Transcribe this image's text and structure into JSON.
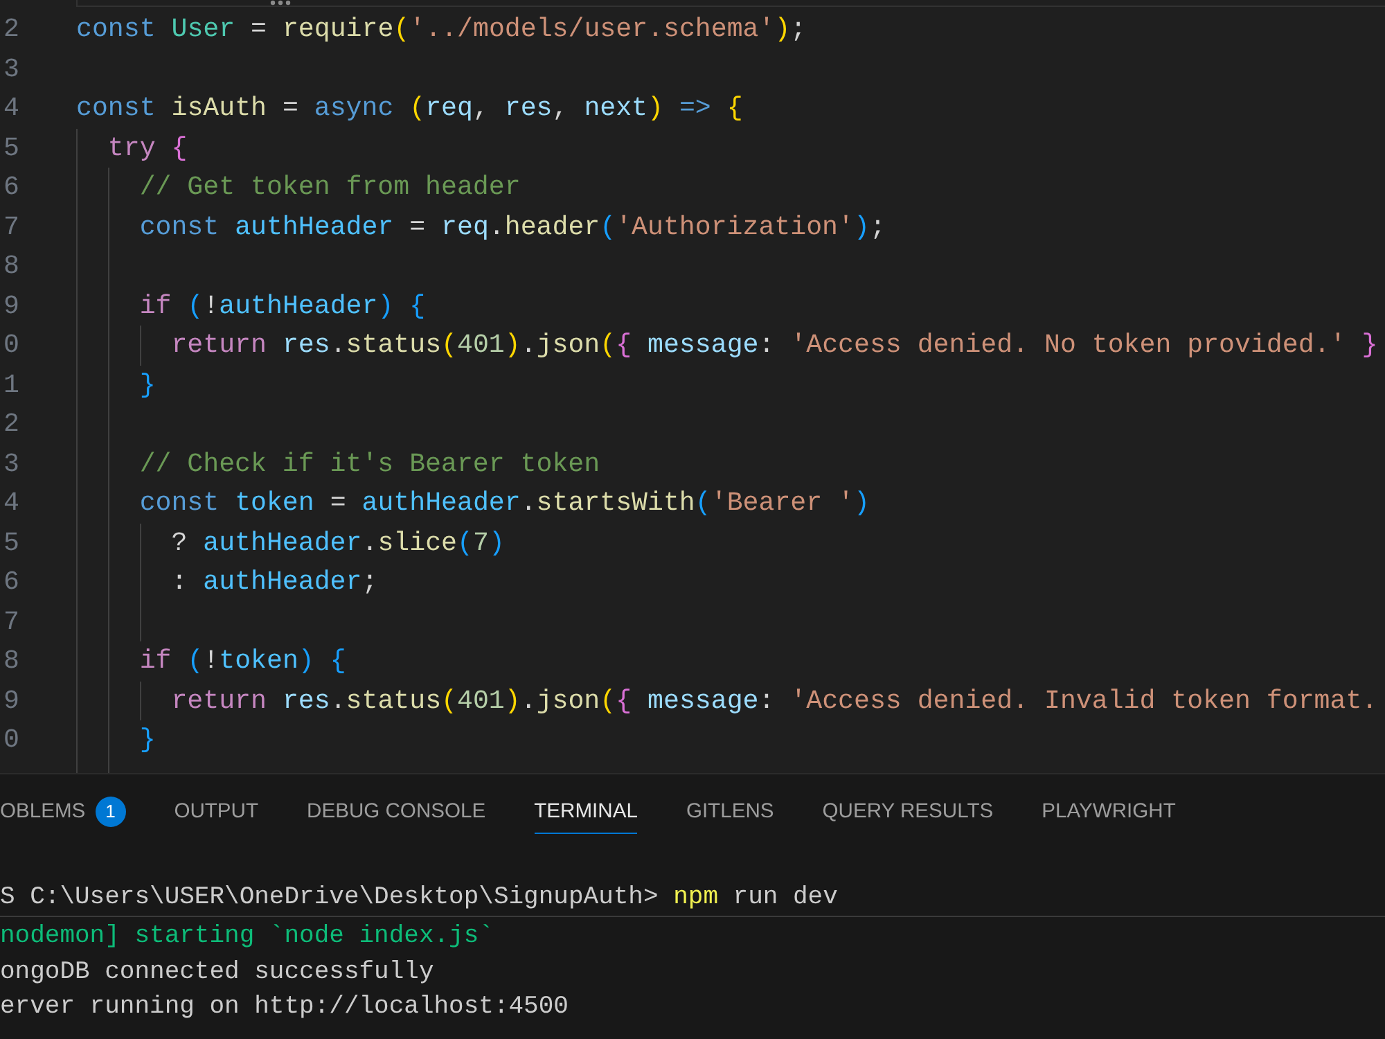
{
  "editor": {
    "lines": [
      {
        "number": "2",
        "tokens": [
          {
            "text": "const ",
            "kind": "keyword"
          },
          {
            "text": "User",
            "kind": "type"
          },
          {
            "text": " = ",
            "kind": "plain"
          },
          {
            "text": "require",
            "kind": "function"
          },
          {
            "text": "(",
            "kind": "bracket1"
          },
          {
            "text": "'../models/user.schema'",
            "kind": "string"
          },
          {
            "text": ")",
            "kind": "bracket1"
          },
          {
            "text": ";",
            "kind": "plain"
          }
        ]
      },
      {
        "number": "3"
      },
      {
        "number": "4",
        "tokens": [
          {
            "text": "const ",
            "kind": "keyword"
          },
          {
            "text": "isAuth",
            "kind": "function"
          },
          {
            "text": " = ",
            "kind": "plain"
          },
          {
            "text": "async ",
            "kind": "keyword"
          },
          {
            "text": "(",
            "kind": "bracket1"
          },
          {
            "text": "req",
            "kind": "variable"
          },
          {
            "text": ", ",
            "kind": "plain"
          },
          {
            "text": "res",
            "kind": "variable"
          },
          {
            "text": ", ",
            "kind": "plain"
          },
          {
            "text": "next",
            "kind": "variable"
          },
          {
            "text": ")",
            "kind": "bracket1"
          },
          {
            "text": " => ",
            "kind": "keyword"
          },
          {
            "text": "{",
            "kind": "bracket1"
          }
        ],
        "children": [
          {
            "number": "5",
            "tokens": [
              {
                "text": "try ",
                "kind": "control"
              },
              {
                "text": "{",
                "kind": "bracket2"
              }
            ],
            "children": [
              {
                "number": "6",
                "tokens": [
                  {
                    "text": "// Get token from header",
                    "kind": "comment"
                  }
                ]
              },
              {
                "number": "7",
                "tokens": [
                  {
                    "text": "const ",
                    "kind": "keyword"
                  },
                  {
                    "text": "authHeader",
                    "kind": "constant"
                  },
                  {
                    "text": " = ",
                    "kind": "plain"
                  },
                  {
                    "text": "req",
                    "kind": "variable"
                  },
                  {
                    "text": ".",
                    "kind": "plain"
                  },
                  {
                    "text": "header",
                    "kind": "function"
                  },
                  {
                    "text": "(",
                    "kind": "bracket3"
                  },
                  {
                    "text": "'Authorization'",
                    "kind": "string"
                  },
                  {
                    "text": ")",
                    "kind": "bracket3"
                  },
                  {
                    "text": ";",
                    "kind": "plain"
                  }
                ]
              },
              {
                "number": "8"
              },
              {
                "number": "9",
                "tokens": [
                  {
                    "text": "if ",
                    "kind": "control"
                  },
                  {
                    "text": "(",
                    "kind": "bracket3"
                  },
                  {
                    "text": "!",
                    "kind": "plain"
                  },
                  {
                    "text": "authHeader",
                    "kind": "constant"
                  },
                  {
                    "text": ") {",
                    "kind": "bracket3"
                  }
                ],
                "children": [
                  {
                    "number": "0",
                    "tokens": [
                      {
                        "text": "return ",
                        "kind": "control"
                      },
                      {
                        "text": "res",
                        "kind": "variable"
                      },
                      {
                        "text": ".",
                        "kind": "plain"
                      },
                      {
                        "text": "status",
                        "kind": "function"
                      },
                      {
                        "text": "(",
                        "kind": "bracket1"
                      },
                      {
                        "text": "401",
                        "kind": "number"
                      },
                      {
                        "text": ")",
                        "kind": "bracket1"
                      },
                      {
                        "text": ".",
                        "kind": "plain"
                      },
                      {
                        "text": "json",
                        "kind": "function"
                      },
                      {
                        "text": "(",
                        "kind": "bracket1"
                      },
                      {
                        "text": "{ ",
                        "kind": "bracket2"
                      },
                      {
                        "text": "message",
                        "kind": "variable"
                      },
                      {
                        "text": ": ",
                        "kind": "plain"
                      },
                      {
                        "text": "'Access denied. No token provided.'",
                        "kind": "string"
                      },
                      {
                        "text": " }",
                        "kind": "bracket2"
                      }
                    ]
                  }
                ]
              },
              {
                "number": "1",
                "tokens": [
                  {
                    "text": "}",
                    "kind": "bracket3"
                  }
                ]
              },
              {
                "number": "2"
              },
              {
                "number": "3",
                "tokens": [
                  {
                    "text": "// Check if it's Bearer token",
                    "kind": "comment"
                  }
                ]
              },
              {
                "number": "4",
                "tokens": [
                  {
                    "text": "const ",
                    "kind": "keyword"
                  },
                  {
                    "text": "token",
                    "kind": "constant"
                  },
                  {
                    "text": " = ",
                    "kind": "plain"
                  },
                  {
                    "text": "authHeader",
                    "kind": "constant"
                  },
                  {
                    "text": ".",
                    "kind": "plain"
                  },
                  {
                    "text": "startsWith",
                    "kind": "function"
                  },
                  {
                    "text": "(",
                    "kind": "bracket3"
                  },
                  {
                    "text": "'Bearer '",
                    "kind": "string"
                  },
                  {
                    "text": ")",
                    "kind": "bracket3"
                  }
                ],
                "children": [
                  {
                    "number": "5",
                    "tokens": [
                      {
                        "text": "? ",
                        "kind": "plain"
                      },
                      {
                        "text": "authHeader",
                        "kind": "constant"
                      },
                      {
                        "text": ".",
                        "kind": "plain"
                      },
                      {
                        "text": "slice",
                        "kind": "function"
                      },
                      {
                        "text": "(",
                        "kind": "bracket3"
                      },
                      {
                        "text": "7",
                        "kind": "number"
                      },
                      {
                        "text": ")",
                        "kind": "bracket3"
                      }
                    ]
                  },
                  {
                    "number": "6",
                    "tokens": [
                      {
                        "text": ": ",
                        "kind": "plain"
                      },
                      {
                        "text": "authHeader",
                        "kind": "constant"
                      },
                      {
                        "text": ";",
                        "kind": "plain"
                      }
                    ]
                  },
                  {
                    "number": "7"
                  }
                ]
              },
              {
                "number": "8",
                "tokens": [
                  {
                    "text": "if ",
                    "kind": "control"
                  },
                  {
                    "text": "(",
                    "kind": "bracket3"
                  },
                  {
                    "text": "!",
                    "kind": "plain"
                  },
                  {
                    "text": "token",
                    "kind": "constant"
                  },
                  {
                    "text": ") {",
                    "kind": "bracket3"
                  }
                ],
                "children": [
                  {
                    "number": "9",
                    "tokens": [
                      {
                        "text": "return ",
                        "kind": "control"
                      },
                      {
                        "text": "res",
                        "kind": "variable"
                      },
                      {
                        "text": ".",
                        "kind": "plain"
                      },
                      {
                        "text": "status",
                        "kind": "function"
                      },
                      {
                        "text": "(",
                        "kind": "bracket1"
                      },
                      {
                        "text": "401",
                        "kind": "number"
                      },
                      {
                        "text": ")",
                        "kind": "bracket1"
                      },
                      {
                        "text": ".",
                        "kind": "plain"
                      },
                      {
                        "text": "json",
                        "kind": "function"
                      },
                      {
                        "text": "(",
                        "kind": "bracket1"
                      },
                      {
                        "text": "{ ",
                        "kind": "bracket2"
                      },
                      {
                        "text": "message",
                        "kind": "variable"
                      },
                      {
                        "text": ": ",
                        "kind": "plain"
                      },
                      {
                        "text": "'Access denied. Invalid token format.",
                        "kind": "string"
                      }
                    ]
                  }
                ]
              },
              {
                "number": "0",
                "tokens": [
                  {
                    "text": "}",
                    "kind": "bracket3"
                  }
                ]
              }
            ]
          }
        ]
      }
    ]
  },
  "panel": {
    "tabs": [
      {
        "label": "OBLEMS",
        "count": "1",
        "selected": false
      },
      {
        "label": "OUTPUT",
        "selected": false
      },
      {
        "label": "DEBUG CONSOLE",
        "selected": false
      },
      {
        "label": "TERMINAL",
        "selected": true
      },
      {
        "label": "GITLENS",
        "selected": false
      },
      {
        "label": "QUERY RESULTS",
        "selected": false
      },
      {
        "label": "PLAYWRIGHT",
        "selected": false
      }
    ],
    "terminal": {
      "sticky_command": {
        "prompt": "S C:\\Users\\USER\\OneDrive\\Desktop\\SignupAuth>",
        "command": "npm",
        "arguments": "run dev"
      },
      "lines": [
        {
          "text": "nodemon] starting `node index.js`",
          "kind": "success"
        },
        {
          "text": "ongoDB connected successfully",
          "kind": "plain"
        },
        {
          "text": "erver running on http://localhost:4500",
          "kind": "plain"
        }
      ]
    }
  }
}
